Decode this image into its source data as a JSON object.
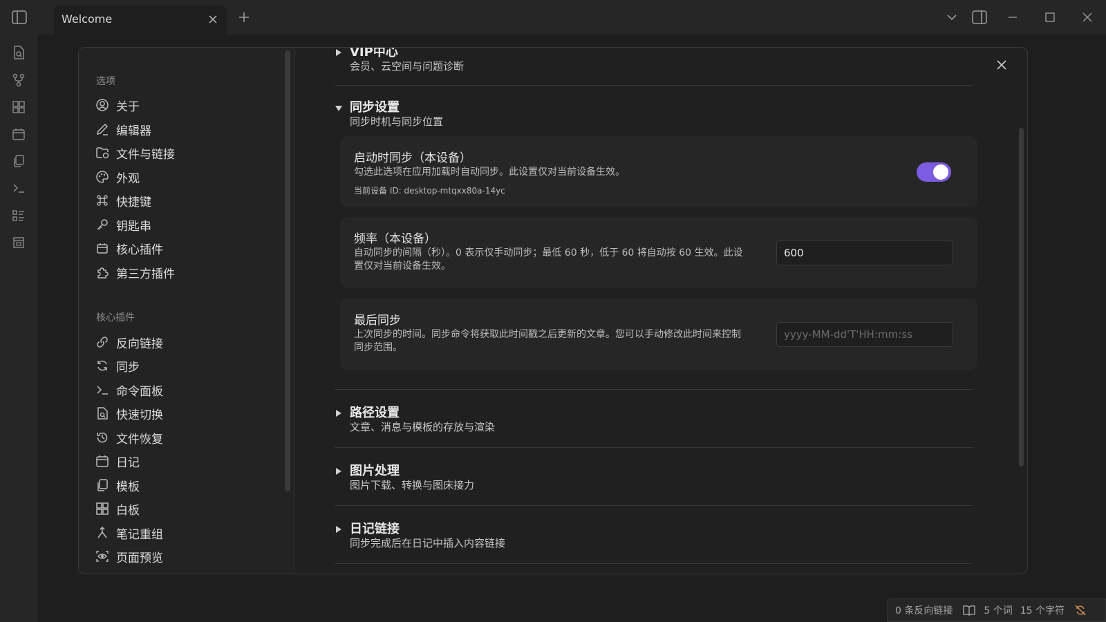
{
  "window": {
    "tab_title": "Welcome",
    "icons": [
      "sidebar-toggle-icon",
      "close-icon",
      "plus-icon",
      "chevron-down-icon",
      "right-sidebar-icon",
      "minimize-icon",
      "maximize-icon",
      "window-close-icon"
    ]
  },
  "ribbon": {
    "icons": [
      "file-search-icon",
      "git-fork-icon",
      "dashboard-icon",
      "calendar-icon",
      "copy-icon",
      "terminal-icon",
      "list-icon",
      "calendar-grid-icon"
    ]
  },
  "nav": {
    "options_heading": "选项",
    "options_items": [
      {
        "label": "关于",
        "icon": "user-circle-icon"
      },
      {
        "label": "编辑器",
        "icon": "pencil-icon"
      },
      {
        "label": "文件与链接",
        "icon": "folder-link-icon"
      },
      {
        "label": "外观",
        "icon": "palette-icon"
      },
      {
        "label": "快捷键",
        "icon": "command-icon"
      },
      {
        "label": "钥匙串",
        "icon": "key-icon"
      },
      {
        "label": "核心插件",
        "icon": "core-plugin-icon"
      },
      {
        "label": "第三方插件",
        "icon": "puzzle-icon"
      }
    ],
    "core_heading": "核心插件",
    "core_items": [
      {
        "label": "反向链接",
        "icon": "backlink-icon"
      },
      {
        "label": "同步",
        "icon": "sync-icon"
      },
      {
        "label": "命令面板",
        "icon": "terminal-icon"
      },
      {
        "label": "快速切换",
        "icon": "file-search-icon"
      },
      {
        "label": "文件恢复",
        "icon": "history-icon"
      },
      {
        "label": "日记",
        "icon": "calendar-icon"
      },
      {
        "label": "模板",
        "icon": "copy-icon"
      },
      {
        "label": "白板",
        "icon": "canvas-icon"
      },
      {
        "label": "笔记重组",
        "icon": "merge-icon"
      },
      {
        "label": "页面预览",
        "icon": "preview-icon"
      }
    ]
  },
  "sections": {
    "vip": {
      "title": "VIP中心",
      "subtitle": "会员、云空间与问题诊断",
      "expanded": false
    },
    "sync": {
      "title": "同步设置",
      "subtitle": "同步时机与同步位置",
      "expanded": true
    },
    "path": {
      "title": "路径设置",
      "subtitle": "文章、消息与模板的存放与渲染",
      "expanded": false
    },
    "image": {
      "title": "图片处理",
      "subtitle": "图片下载、转换与图床接力",
      "expanded": false
    },
    "diary": {
      "title": "日记链接",
      "subtitle": "同步完成后在日记中插入内容链接",
      "expanded": false
    }
  },
  "settings": {
    "startup_sync": {
      "title": "启动时同步（本设备）",
      "desc": "勾选此选项在应用加载时自动同步。此设置仅对当前设备生效。",
      "device_id": "当前设备 ID: desktop-mtqxx80a-14yc",
      "enabled": true
    },
    "frequency": {
      "title": "频率（本设备）",
      "desc_line1": "自动同步的间隔（秒）。0 表示仅手动同步；最低 60 秒，低于 60 将自动按 60 生效。此设",
      "desc_line2": "置仅对当前设备生效。",
      "value": "600"
    },
    "last_sync": {
      "title": "最后同步",
      "desc_line1": "上次同步的时间。同步命令将获取此时间戳之后更新的文章。您可以手动修改此时间来控制",
      "desc_line2": "同步范围。",
      "value": "",
      "placeholder": "yyyy-MM-dd'T'HH:mm:ss"
    }
  },
  "status_bar": {
    "backlinks": "0 条反向链接",
    "words": "5 个词",
    "chars": "15 个字符"
  },
  "colors": {
    "accent": "#7c5ce0",
    "background": "#1e1e1e",
    "modal": "#202020"
  }
}
